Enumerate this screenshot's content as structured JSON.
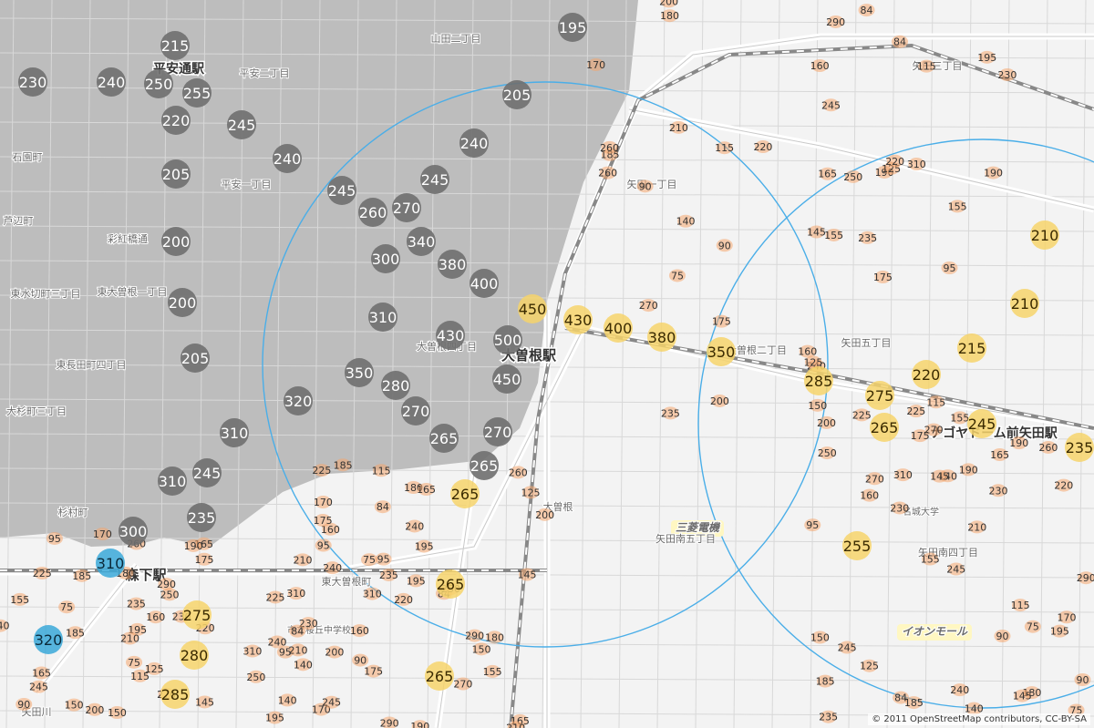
{
  "map": {
    "attribution": "© 2011 OpenStreetMap contributors, CC-BY-SA",
    "colors": {
      "gray_marker": "#6f6f6f",
      "yellow_marker": "#f6d36b",
      "blue_marker": "#3aa8d8",
      "orange_label": "#f4a56e",
      "search_circle": "#4aaee8",
      "road": "#a0522d",
      "railway": "#888888"
    },
    "place_labels": [
      {
        "text": "大曽根駅",
        "kind": "station"
      },
      {
        "text": "森下駅",
        "kind": "station"
      },
      {
        "text": "平安通駅",
        "kind": "station"
      },
      {
        "text": "ナゴヤドーム前矢田駅",
        "kind": "station"
      },
      {
        "text": "三菱電機",
        "kind": "landmark"
      },
      {
        "text": "イオンモール",
        "kind": "landmark"
      },
      {
        "text": "名城大学",
        "kind": "area"
      },
      {
        "text": "矢田南五丁目",
        "kind": "area"
      },
      {
        "text": "矢田南四丁目",
        "kind": "area"
      },
      {
        "text": "矢田一丁目",
        "kind": "area"
      },
      {
        "text": "矢田三丁目",
        "kind": "area"
      },
      {
        "text": "矢田五丁目",
        "kind": "area"
      },
      {
        "text": "大曽根二丁目",
        "kind": "area"
      },
      {
        "text": "大曽根四丁目",
        "kind": "area"
      },
      {
        "text": "東大曽根町",
        "kind": "area"
      },
      {
        "text": "大曽根",
        "kind": "area"
      },
      {
        "text": "山田二丁目",
        "kind": "area"
      },
      {
        "text": "東大曽根一丁目",
        "kind": "area"
      },
      {
        "text": "東長田町四丁目",
        "kind": "area"
      },
      {
        "text": "東水切町三丁目",
        "kind": "area"
      },
      {
        "text": "大杉町三丁目",
        "kind": "area"
      },
      {
        "text": "平安二丁目",
        "kind": "area"
      },
      {
        "text": "平安一丁目",
        "kind": "area"
      },
      {
        "text": "石園町",
        "kind": "area"
      },
      {
        "text": "芦辺町",
        "kind": "area"
      },
      {
        "text": "杉村町",
        "kind": "area"
      },
      {
        "text": "彩紅橋通",
        "kind": "area"
      },
      {
        "text": "市立桜丘中学校",
        "kind": "school"
      },
      {
        "text": "矢田川",
        "kind": "area"
      }
    ],
    "gray_markers": [
      "195",
      "215",
      "230",
      "240",
      "250",
      "255",
      "220",
      "245",
      "240",
      "205",
      "200",
      "200",
      "205",
      "310",
      "310",
      "245",
      "235",
      "300",
      "205",
      "240",
      "245",
      "245",
      "260",
      "270",
      "340",
      "300",
      "380",
      "400",
      "310",
      "430",
      "500",
      "350",
      "280",
      "270",
      "320",
      "450",
      "265",
      "270",
      "265"
    ],
    "yellow_markers": [
      "450",
      "430",
      "400",
      "380",
      "350",
      "285",
      "275",
      "265",
      "245",
      "220",
      "215",
      "210",
      "210",
      "235",
      "255",
      "265",
      "265",
      "265",
      "275",
      "280",
      "285"
    ],
    "blue_markers": [
      "310",
      "320"
    ],
    "price_labels": [
      "155",
      "160",
      "195",
      "185",
      "190",
      "175",
      "165",
      "140",
      "115",
      "84",
      "95",
      "75",
      "90",
      "200",
      "210",
      "230",
      "235",
      "240",
      "250",
      "245",
      "220",
      "170",
      "150",
      "145",
      "125",
      "180",
      "225",
      "270",
      "260",
      "290",
      "310"
    ]
  }
}
